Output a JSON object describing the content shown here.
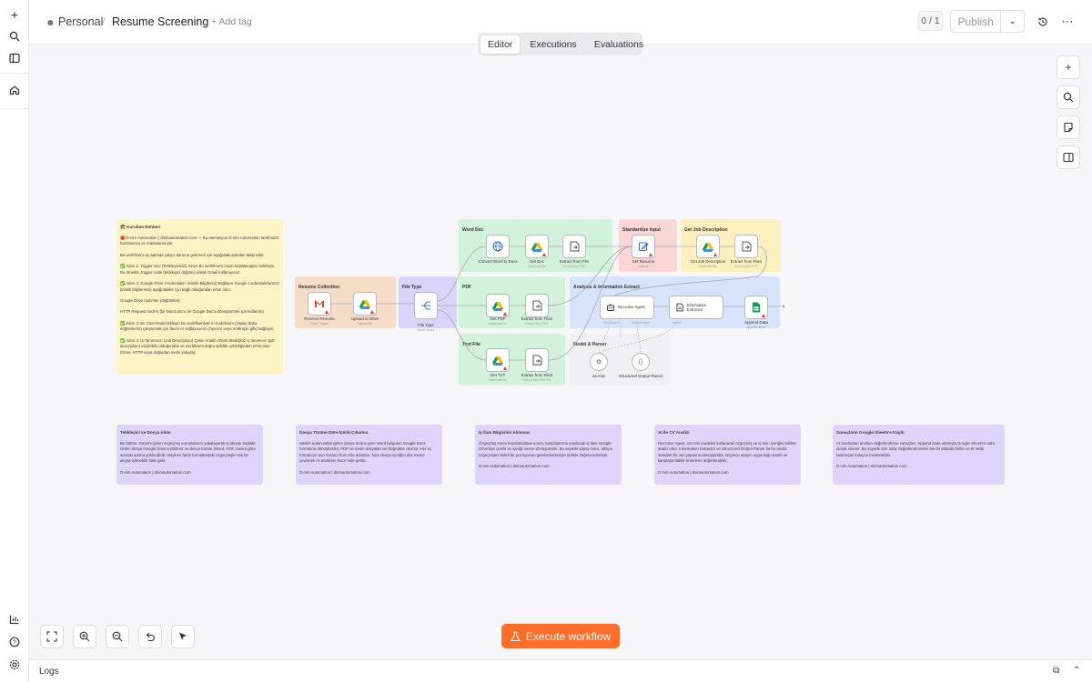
{
  "rail": {
    "icons": [
      "plus-icon",
      "search-icon",
      "sidebar-icon",
      "home-icon",
      "chart-icon",
      "help-icon",
      "settings-icon"
    ]
  },
  "header": {
    "project": "Personal",
    "separator": "/",
    "workflow_name": "Resume Screening",
    "add_tag": "+ Add tag",
    "version": "0 / 1",
    "publish": "Publish",
    "tabs": [
      "Editor",
      "Executions",
      "Evaluations"
    ],
    "active_tab": "Editor"
  },
  "canvas": {
    "setup_note": {
      "title": "🛠 Kurulum Rehberi",
      "paragraphs": [
        "🔴 D-nim Automation | dnimautomation.com — Bu otomasyon D-nim Automation tarafından hazırlanmış ve markalanmıştır.",
        "Bu workflow'u üç adımda çalışır duruma getirmek için aşağıdaki adımları takip edin:",
        "✅ Adım 1: Trigger'ınızı (Tetikleyicinizi) Seçin\nBu workflow'u neyin başlatacağını belirleyin. Bu örnekte, trigger node (tetikleyici düğüm) olarak Gmail kullanıyoruz.",
        "✅ Adım 2: Google Drive Credentials'ı (Kimlik Bilgilerini) Bağlayın\nGoogle credentials'larınızı (kimlik bilgilerinizi) aşağıdakiler için bağlı olduğundan emin olun:",
        "Google Drive node'ları (düğümleri)",
        "HTTP Request node'u (bir Word doc'u bir Google Doc'a dönüştürmek için kullanılır)",
        "✅ Adım 3: Bir Chat Model Ekleyin\nBu workflow'daki AI node'larını (Yapay Zeka düğümlerini) çalıştırmak için favori AI sağlayıcınızı (OpenAI veya Anthropic gibi) bağlayın.",
        "✅ Adım 4: İş Tanımınızı (Job Description) Çekin\nAnaliz etmek istediğiniz iş tanımının (job description) erişilebilir olduğundan ve workflow'a doğru şekilde çekildiğinden emin olun (Drive, HTTP veya doğrudan metin yoluyla)."
      ]
    },
    "groups": {
      "resume_collection": "Resume Collection",
      "file_type": "File Type",
      "word_doc": "Word Doc",
      "pdf": "PDF",
      "text_file": "Text File",
      "standardize_input": "Standardize Input",
      "get_job_description": "Get Job Description",
      "analysis": "Analysis & Information Extract",
      "model_parser": "Model & Parser"
    },
    "nodes": {
      "receive_resume": {
        "label": "Receive Resume",
        "sub": "Gmail Trigger"
      },
      "upload_drive": {
        "label": "Upload to Drive",
        "sub": "Upload file"
      },
      "file_type": {
        "label": "File Type",
        "sub": "Mode: Rules"
      },
      "convert_word": {
        "label": "Convert Word to Docs",
        "sub": ""
      },
      "get_doc": {
        "label": "Get Doc",
        "sub": "download file"
      },
      "extract_file": {
        "label": "Extract from File",
        "sub": "Extract from PDF"
      },
      "get_pdf": {
        "label": "Get PDF",
        "sub": "download file"
      },
      "extract_file2": {
        "label": "Extract from File2",
        "sub": "Extract from PDF"
      },
      "get_txt": {
        "label": "Get TXT",
        "sub": "download file"
      },
      "extract_file3": {
        "label": "Extract from File3",
        "sub": "Extract from Text File"
      },
      "set_resume": {
        "label": "Set Resume",
        "sub": "manual"
      },
      "get_job_desc": {
        "label": "Get Job Description",
        "sub": "download file"
      },
      "extract_file1": {
        "label": "Extract from File1",
        "sub": "Extract from PDF"
      },
      "recruiter_agent": {
        "label": "Recruiter Agent"
      },
      "info_extractor": {
        "label": "Information Extractor"
      },
      "append_data": {
        "label": "Append Data",
        "sub": "append: sheet"
      },
      "model": {
        "label": "o4-mini"
      },
      "parser": {
        "label": "Structured Output Parser"
      }
    },
    "port_labels": {
      "chat_model": "Chat Model*",
      "output_parser": "Output Parser",
      "model": "Model*"
    },
    "notes": [
      {
        "title": "Tetikleyici ve Dosya Alımı",
        "body": "Bu bölüm, Gmail'e gelen özgeçmiş e-postalarını yakalayarak iş akışını başlatır. Gelen dosya Google Drive'a yüklenir ve dosya türüne (Word, PDF, metin) göre sonraki adıma yönlendirilir. Böylece farklı formatlardaki özgeçmişler tek bir akışta işlenebilir hale gelir.",
        "footer": "D-nim Automation | dnimautomation.com"
      },
      {
        "title": "Dosya Türüne Göre İçerik Çıkarma",
        "body": "Switch node'undan gelen dosya türüne göre Word belgeleri Google Docs formatına dönüştürülür, PDF ve metin dosyaları ise doğrudan okunur. Her üç format için ayrı Extract from File adımları, ham dosya içeriğini düz metne çevirerek AI analizine hazır hale getirir.",
        "footer": "D-nim Automation | dnimautomation.com"
      },
      {
        "title": "İş İlanı Bilgisinin Alınması",
        "body": "Özgeçmiş metni hazırlandıktan sonra, karşılaştırma yapılacak iş ilanı Google Drive'dan çekilir ve içeriği metne dönüştürülür. Bu sayede yapay zeka, adayın özgeçmişini belirli bir pozisyonun gereksinimleriyle birlikte değerlendirebilir.",
        "footer": "D-nim Automation | dnimautomation.com"
      },
      {
        "title": "AI ile CV Analizi",
        "body": "Recruiter Agent, o4-mini modelini kullanarak özgeçmiş ve iş ilanı içeriğini birlikte analiz eder. Information Extractor ve Structured Output Parser ile bu analiz standart bir veri yapısına dönüştürülür. Böylece adayın uygunluğu tutarlı ve karşılaştırılabilir kriterlerle değerlendirilir.",
        "footer": "D-nim Automation | dnimautomation.com"
      },
      {
        "title": "Sonuçların Google Sheets'e Kaydı",
        "body": "AI tarafından üretilen değerlendirme sonuçları, Append Data adımıyla Google Sheets'e satır olarak eklenir. Bu sayede tüm aday değerlendirmeleri tek bir tabloda birikir ve İK ekibi tarafından kolayca incelenebilir.",
        "footer": "D-nim Automation | dnimautomation.com"
      }
    ]
  },
  "toolbar": {
    "execute": "Execute workflow",
    "right_icons": [
      "plus-icon",
      "search-icon",
      "sticky-note-icon",
      "panel-icon"
    ],
    "bottom_icons": [
      "fit-view-icon",
      "zoom-in-icon",
      "zoom-out-icon",
      "undo-icon",
      "pointer-icon"
    ]
  },
  "logs": {
    "label": "Logs"
  },
  "colors": {
    "accent": "#ff6d2b",
    "note_yellow": "#fdf3c4",
    "note_purple": "#ddd5fb"
  }
}
